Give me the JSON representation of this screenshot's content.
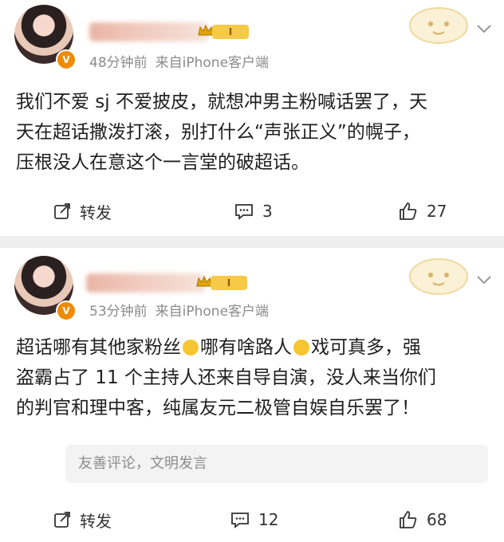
{
  "post1": {
    "time": "48分钟前",
    "source": "来自iPhone客户端",
    "rank_badge": "I",
    "text_lines": [
      "我们不爱 sj 不爱披皮，就想冲男主粉喊话罢了，天",
      "天在超话撒泼打滚，别打什么“声张正义”的幌子，",
      "压根没人在意这个一言堂的破超话。"
    ],
    "actions": {
      "repost": "转发",
      "comments": "3",
      "likes": "27"
    }
  },
  "post2": {
    "time": "53分钟前",
    "source": "来自iPhone客户端",
    "rank_badge": "I",
    "text_lines": [
      [
        "超话哪有其他家粉丝",
        "哪有啥路人",
        "戏可真多，强"
      ],
      "盗霸占了 11 个主持人还来自导自演，没人来当你们",
      "的判官和理中客，纯属友元二极管自娱自乐罢了！"
    ],
    "comment_placeholder": "友善评论，文明发言",
    "actions": {
      "repost": "转发",
      "comments": "12",
      "likes": "68"
    }
  },
  "colors": {
    "accent": "#f08a00",
    "meta": "#8b8b8b",
    "separator": "#eeeeee"
  },
  "icons": [
    "repost-icon",
    "comment-icon",
    "like-icon",
    "chevron-down-icon",
    "verified-badge-icon",
    "emoji-laugh-icon"
  ]
}
